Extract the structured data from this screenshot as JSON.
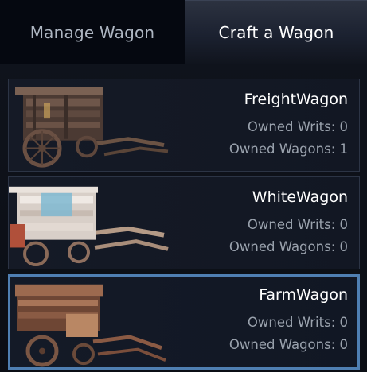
{
  "tabs": [
    {
      "label": "Manage Wagon",
      "active": false
    },
    {
      "label": "Craft a Wagon",
      "active": true
    }
  ],
  "wagons": [
    {
      "name": "FreightWagon",
      "writs_label": "Owned Writs: 0",
      "wagons_label": "Owned Wagons: 1",
      "selected": false
    },
    {
      "name": "WhiteWagon",
      "writs_label": "Owned Writs: 0",
      "wagons_label": "Owned Wagons: 0",
      "selected": false
    },
    {
      "name": "FarmWagon",
      "writs_label": "Owned Writs: 0",
      "wagons_label": "Owned Wagons: 0",
      "selected": true
    }
  ],
  "colors": {
    "selected_border": "#4f7fb2",
    "card_border": "#2c3445",
    "text_primary": "#ffffff",
    "text_secondary": "#9aa2ad"
  }
}
